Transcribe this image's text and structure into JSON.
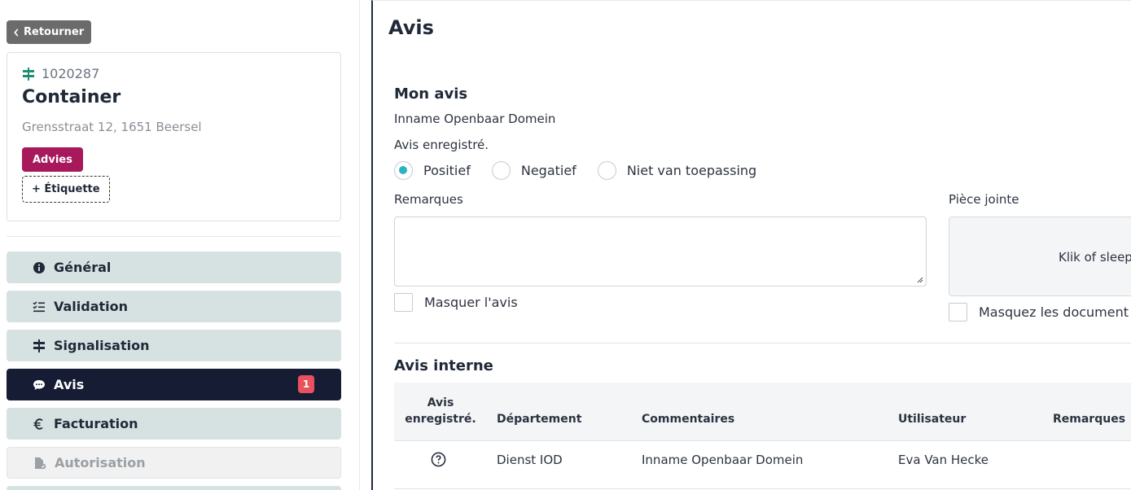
{
  "sidebar": {
    "back_label": "Retourner",
    "card": {
      "id": "1020287",
      "title": "Container",
      "address": "Grensstraat 12, 1651 Beersel",
      "tag": "Advies",
      "add_tag_label": "+ Étiquette"
    },
    "nav": [
      {
        "label": "Général",
        "icon": "info-icon"
      },
      {
        "label": "Validation",
        "icon": "checklist-icon"
      },
      {
        "label": "Signalisation",
        "icon": "signpost-icon"
      },
      {
        "label": "Avis",
        "icon": "chat-icon",
        "badge": "1",
        "active": true
      },
      {
        "label": "Facturation",
        "icon": "euro-icon"
      },
      {
        "label": "Autorisation",
        "icon": "document-check-icon",
        "disabled": true
      }
    ]
  },
  "main": {
    "title": "Avis",
    "my_opinion": {
      "title": "Mon avis",
      "subject": "Inname Openbaar Domein",
      "status_label": "Avis enregistré.",
      "options": [
        "Positief",
        "Negatief",
        "Niet van toepassing"
      ],
      "selected": "Positief",
      "remarks_label": "Remarques",
      "remarks_value": "",
      "hide_label": "Masquer l'avis",
      "attachment_label": "Pièce jointe",
      "dropzone_text": "Klik of sleep",
      "hide_documents_label": "Masquez les document"
    },
    "internal": {
      "title": "Avis interne",
      "columns": [
        "Avis enregistré.",
        "Département",
        "Commentaires",
        "Utilisateur",
        "Remarques"
      ],
      "rows": [
        {
          "status_icon": "question-circle-icon",
          "department": "Dienst IOD",
          "comment": "Inname Openbaar Domein",
          "user": "Eva Van Hecke",
          "remarks": ""
        }
      ]
    }
  },
  "colors": {
    "accent": "#2ab3c2",
    "active_nav": "#151c33",
    "nav_bg": "#d6e1e1",
    "tag": "#a8195c",
    "badge": "#e8515d"
  }
}
